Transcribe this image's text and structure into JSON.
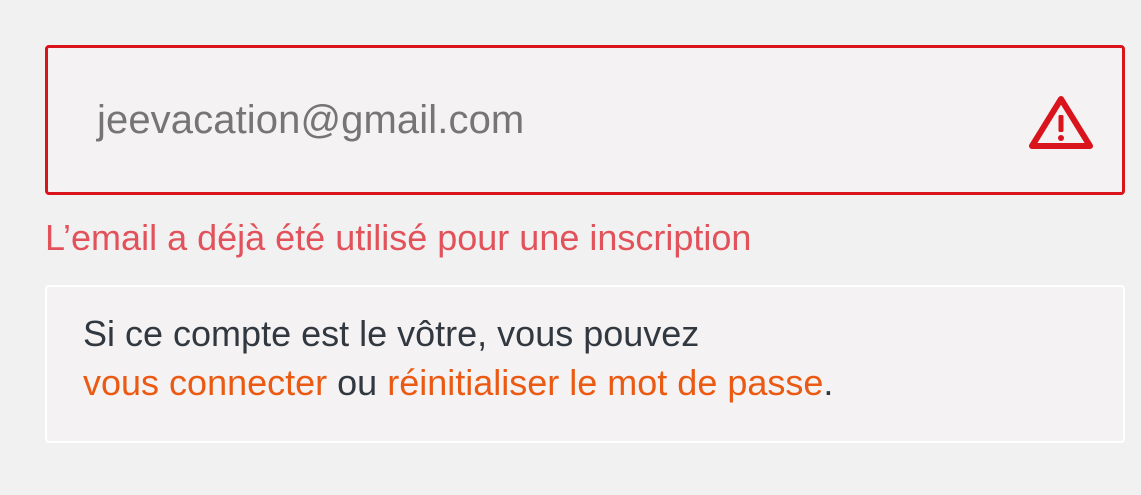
{
  "email_field": {
    "value": "jeevacation@gmail.com",
    "status_icon": "warning-triangle-icon",
    "border_color": "#d9141d"
  },
  "error": {
    "message": "L’email a déjà été utilisé pour une inscription",
    "color": "#e2525a"
  },
  "info": {
    "line1": "Si ce compte est le vôtre, vous pouvez",
    "login_link": "vous connecter",
    "separator": " ou ",
    "reset_link": "réinitialiser le mot de passe",
    "end": ".",
    "link_color": "#eb5a13"
  }
}
